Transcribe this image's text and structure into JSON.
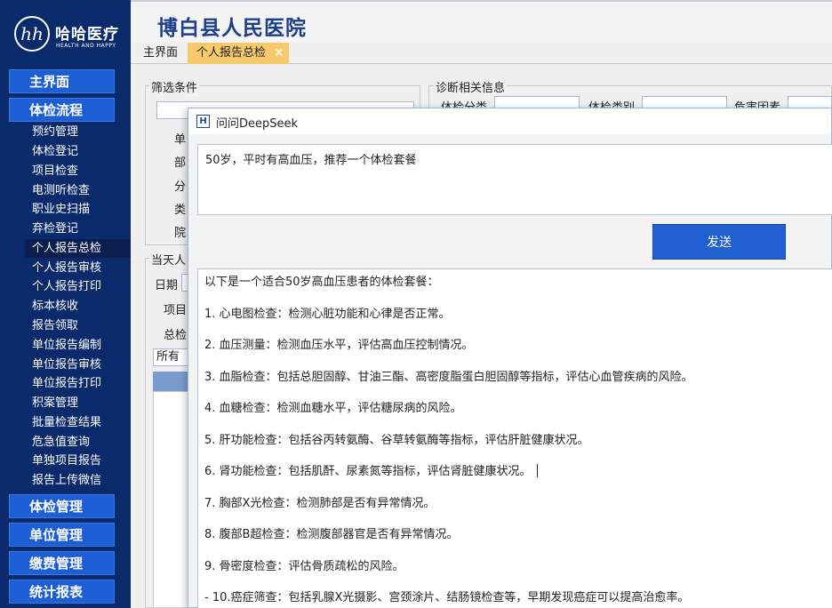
{
  "brand": {
    "mark": "hh",
    "name": "哈哈医疗",
    "sub": "HEALTH AND HAPPY"
  },
  "app_title": "博白县人民医院",
  "tabs": [
    {
      "label": "主界面"
    },
    {
      "label": "个人报告总检",
      "close": "×"
    }
  ],
  "sidebar": {
    "main_home": "主界面",
    "main_flow": "体检流程",
    "flow_items": [
      "预约管理",
      "体检登记",
      "项目检查",
      "电测听检查",
      "职业史扫描",
      "弃检登记",
      "个人报告总检",
      "个人报告审核",
      "个人报告打印",
      "标本核收",
      "报告领取",
      "单位报告编制",
      "单位报告审核",
      "单位报告打印",
      "积案管理",
      "批量检查结果",
      "危急值查询",
      "单独项目报告",
      "报告上传微信"
    ],
    "main_mgmt": "体检管理",
    "main_unit": "单位管理",
    "main_fee": "缴费管理",
    "main_stats": "统计报表"
  },
  "filter": {
    "title": "筛选条件",
    "labels": [
      "单",
      "部",
      "分",
      "类",
      "院"
    ]
  },
  "diag": {
    "title": "诊断相关信息",
    "labels": [
      "体检分类",
      "体检类别",
      "危害因素"
    ]
  },
  "today": {
    "title": "当天人",
    "date_label": "日期",
    "item_label": "项目",
    "summary_label": "总检",
    "all_option": "所有"
  },
  "dialog": {
    "title": "问问DeepSeek",
    "question": "50岁，平时有高血压，推荐一个体检套餐",
    "send": "发送",
    "answer_lines": [
      "以下是一个适合50岁高血压患者的体检套餐：",
      "1.  心电图检查：检测心脏功能和心律是否正常。",
      "2.  血压测量：检测血压水平，评估高血压控制情况。",
      "3.  血脂检查：包括总胆固醇、甘油三酯、高密度脂蛋白胆固醇等指标，评估心血管疾病的风险。",
      "4.  血糖检查：检测血糖水平，评估糖尿病的风险。",
      "5.  肝功能检查：包括谷丙转氨酶、谷草转氨酶等指标，评估肝脏健康状况。",
      "6.  肾功能检查：包括肌酐、尿素氮等指标，评估肾脏健康状况。",
      "7.  胸部X光检查：检测肺部是否有异常情况。",
      "8.  腹部B超检查：检测腹部器官是否有异常情况。",
      "9.  骨密度检查：评估骨质疏松的风险。",
      "-  10.癌症筛查：包括乳腺X光摄影、宫颈涂片、结肠镜检查等，早期发现癌症可以提高治愈率。"
    ]
  }
}
